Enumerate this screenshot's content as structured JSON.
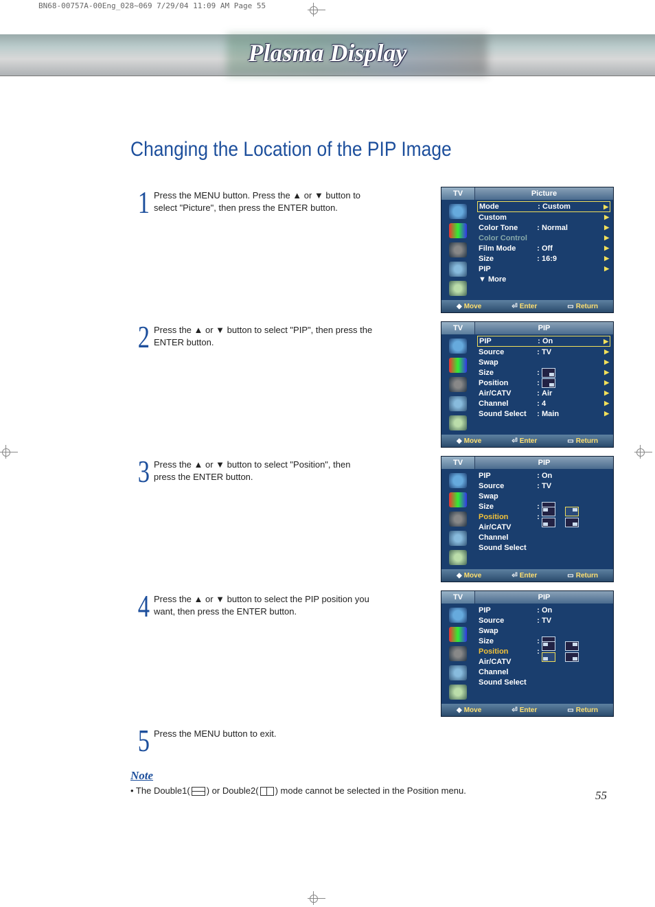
{
  "header_line": "BN68-00757A-00Eng_028~069  7/29/04  11:09 AM  Page 55",
  "banner_title": "Plasma Display",
  "title": "Changing the Location of the PIP Image",
  "steps": [
    {
      "num": "1",
      "text": "Press the MENU button. Press the ▲ or ▼ button to select \"Picture\", then press the ENTER button."
    },
    {
      "num": "2",
      "text": "Press the ▲ or ▼ button to select \"PIP\", then press the ENTER button."
    },
    {
      "num": "3",
      "text": "Press the ▲ or ▼ button to select \"Position\", then press the ENTER button."
    },
    {
      "num": "4",
      "text": "Press the ▲ or ▼ button to select the PIP position you want, then press the ENTER button."
    },
    {
      "num": "5",
      "text": "Press the MENU button to exit."
    }
  ],
  "osd_footer": {
    "move": "Move",
    "enter": "Enter",
    "return": "Return"
  },
  "osd1": {
    "left_title": "TV",
    "right_title": "Picture",
    "rows": [
      {
        "lab": "Mode",
        "val": "Custom",
        "sel": true,
        "arr": true
      },
      {
        "lab": "Custom",
        "val": "",
        "arr": true
      },
      {
        "lab": "Color Tone",
        "val": "Normal",
        "arr": true
      },
      {
        "lab": "Color Control",
        "val": "",
        "gray": true,
        "arr": true
      },
      {
        "lab": "Film Mode",
        "val": "Off",
        "arr": true
      },
      {
        "lab": "Size",
        "val": "16:9",
        "arr": true
      },
      {
        "lab": "PIP",
        "val": "",
        "arr": true
      },
      {
        "lab": "▼ More",
        "val": "",
        "arr": false
      }
    ]
  },
  "osd2": {
    "left_title": "TV",
    "right_title": "PIP",
    "rows": [
      {
        "lab": "PIP",
        "val": "On",
        "sel": true,
        "arr": true
      },
      {
        "lab": "Source",
        "val": "TV",
        "arr": true
      },
      {
        "lab": "Swap",
        "val": "",
        "arr": true
      },
      {
        "lab": "Size",
        "val": "",
        "icon": "br",
        "arr": true
      },
      {
        "lab": "Position",
        "val": "",
        "icon": "br",
        "arr": true
      },
      {
        "lab": "Air/CATV",
        "val": "Air",
        "arr": true
      },
      {
        "lab": "Channel",
        "val": "4",
        "arr": true
      },
      {
        "lab": "Sound Select",
        "val": "Main",
        "arr": true
      }
    ]
  },
  "osd3": {
    "left_title": "TV",
    "right_title": "PIP",
    "rows": [
      {
        "lab": "PIP",
        "val": "On"
      },
      {
        "lab": "Source",
        "val": "TV"
      },
      {
        "lab": "Swap",
        "val": ""
      },
      {
        "lab": "Size",
        "val": "",
        "icon": "br"
      },
      {
        "lab": "Position",
        "val": "",
        "hl": true,
        "posgrid": true,
        "active": "tr"
      },
      {
        "lab": "Air/CATV",
        "val": ""
      },
      {
        "lab": "Channel",
        "val": ""
      },
      {
        "lab": "Sound Select",
        "val": ""
      }
    ]
  },
  "osd4": {
    "left_title": "TV",
    "right_title": "PIP",
    "rows": [
      {
        "lab": "PIP",
        "val": "On"
      },
      {
        "lab": "Source",
        "val": "TV"
      },
      {
        "lab": "Swap",
        "val": ""
      },
      {
        "lab": "Size",
        "val": "",
        "icon": "br"
      },
      {
        "lab": "Position",
        "val": "",
        "hl": true,
        "posgrid": true,
        "active": "bl"
      },
      {
        "lab": "Air/CATV",
        "val": ""
      },
      {
        "lab": "Channel",
        "val": ""
      },
      {
        "lab": "Sound Select",
        "val": ""
      }
    ]
  },
  "note_head": "Note",
  "note_body_pre": "•  The Double1(",
  "note_body_mid": ") or Double2(",
  "note_body_post": ") mode cannot be selected in the Position menu.",
  "page_num": "55"
}
